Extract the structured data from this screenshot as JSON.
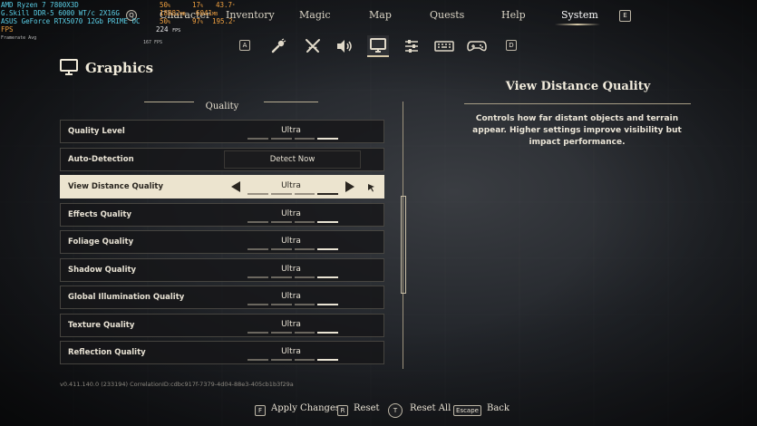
{
  "overlay": {
    "cpu": "AMD Ryzen 7 7800X3D",
    "ram": "G.Skill DDR-5 6000 WT/c 2X16G",
    "gpu": "ASUS GeForce RTX5070 12Gb PRIME OC",
    "fps_label": "FPS",
    "framerate_label": "Framerate Avg",
    "v1": "50",
    "v1_unit": "%",
    "v2": "17",
    "v2_unit": "%",
    "v3": "43.7",
    "v3_unit": "°",
    "v4": "18882",
    "v4_unit": "MB",
    "v5": "6041",
    "v5_unit": "MB",
    "v6": "50",
    "v6_unit": "%",
    "v7": "97",
    "v7_unit": "%",
    "v8": "195.2",
    "v8_unit": "°",
    "fps": "224",
    "fps_unit": "FPS",
    "avg": "167 FPS"
  },
  "nav": {
    "tabs": [
      "Character",
      "Inventory",
      "Magic",
      "Map",
      "Quests",
      "Help",
      "System"
    ],
    "active_tab": "System",
    "left_key": "Q",
    "right_key": "E",
    "icons_left_key": "A",
    "icons_right_key": "D",
    "icons": [
      "torch-icon",
      "swords-icon",
      "speaker-icon",
      "monitor-icon",
      "sliders-icon",
      "keyboard-icon",
      "gamepad-icon"
    ],
    "active_icon": "monitor-icon"
  },
  "page": {
    "title": "Graphics",
    "section": "Quality"
  },
  "settings": [
    {
      "label": "Quality Level",
      "value": "Ultra",
      "level": 4,
      "type": "option"
    },
    {
      "label": "Auto-Detection",
      "value": "Detect Now",
      "type": "button"
    },
    {
      "label": "View Distance Quality",
      "value": "Ultra",
      "level": 4,
      "type": "option",
      "selected": true
    },
    {
      "label": "Effects Quality",
      "value": "Ultra",
      "level": 4,
      "type": "option"
    },
    {
      "label": "Foliage Quality",
      "value": "Ultra",
      "level": 4,
      "type": "option"
    },
    {
      "label": "Shadow Quality",
      "value": "Ultra",
      "level": 4,
      "type": "option"
    },
    {
      "label": "Global Illumination Quality",
      "value": "Ultra",
      "level": 4,
      "type": "option"
    },
    {
      "label": "Texture Quality",
      "value": "Ultra",
      "level": 4,
      "type": "option"
    },
    {
      "label": "Reflection Quality",
      "value": "Ultra",
      "level": 4,
      "type": "option"
    }
  ],
  "levels_total": 4,
  "detail": {
    "title": "View Distance Quality",
    "description": "Controls how far distant objects and terrain appear. Higher settings improve visibility but impact performance."
  },
  "version": "v0.411.140.0 (233194) CorrelationID:cdbc917f-7379-4d04-88e3-405cb1b3f29a",
  "footer": [
    {
      "key": "F",
      "label": "Apply Changes"
    },
    {
      "key": "R",
      "label": "Reset"
    },
    {
      "key": "T",
      "label": "Reset All"
    },
    {
      "key": "Escape",
      "label": "Back"
    }
  ],
  "colors": {
    "accent": "#ece4cf",
    "panel": "#161618",
    "overlay_cyan": "#5bd0e8",
    "overlay_orange": "#f0a040"
  }
}
